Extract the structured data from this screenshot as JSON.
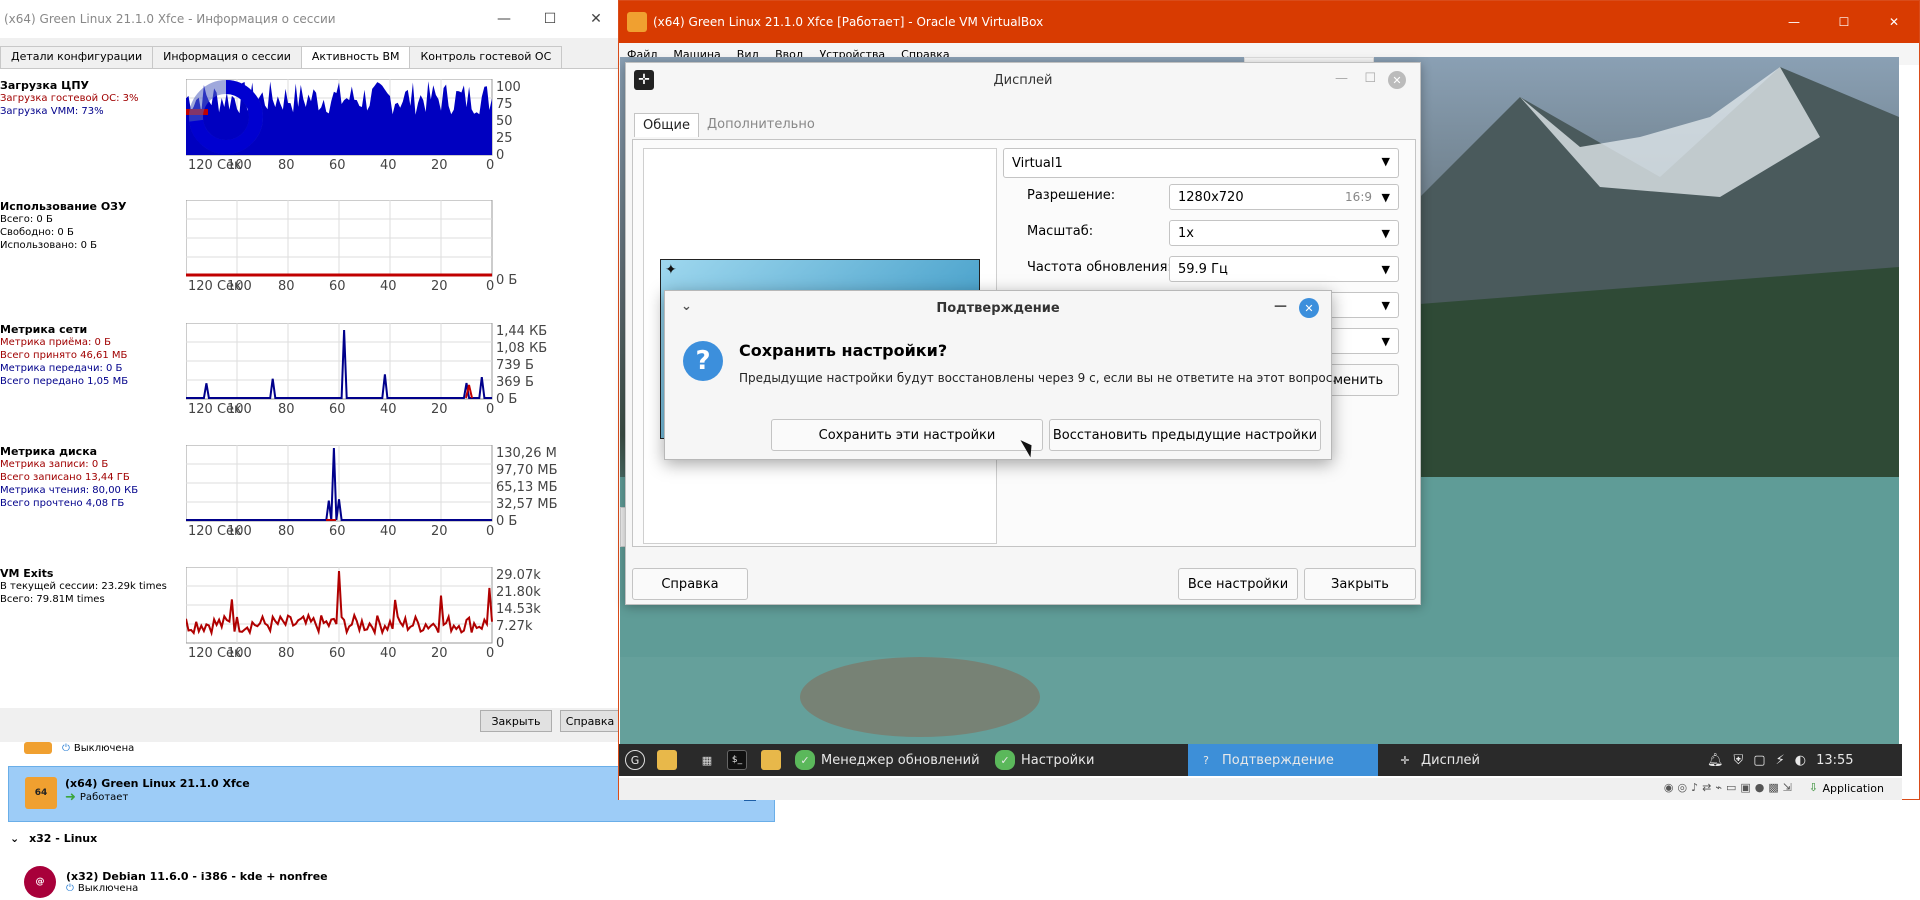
{
  "session_window": {
    "title": "(x64) Green Linux 21.1.0 Xfce - Информация о сессии",
    "tabs": [
      "Детали конфигурации",
      "Информация о сессии",
      "Активность ВМ",
      "Контроль гостевой ОС"
    ],
    "active_tab": 2,
    "x_ticks": [
      "120 Сек",
      "100",
      "80",
      "60",
      "40",
      "20",
      "0"
    ],
    "cpu": {
      "heading": "Загрузка ЦПУ",
      "lines": [
        "Загрузка гостевой ОС: 3%",
        "Загрузка VMM: 73%"
      ],
      "y_ticks": [
        "100",
        "75",
        "50",
        "25",
        "0"
      ],
      "donut_percent": 73
    },
    "ram": {
      "heading": "Использование ОЗУ",
      "lines": [
        "Всего: 0 Б",
        "Свободно: 0 Б",
        "Использовано: 0 Б"
      ],
      "y_ticks": [
        "0 Б"
      ]
    },
    "net": {
      "heading": "Метрика сети",
      "lines": [
        "Метрика приёма: 0 Б",
        "Всего принято 46,61 МБ",
        "Метрика передачи: 0 Б",
        "Всего передано 1,05 МБ"
      ],
      "y_ticks": [
        "1,44 КБ",
        "1,08 КБ",
        "739 Б",
        "369 Б",
        "0 Б"
      ]
    },
    "disk": {
      "heading": "Метрика диска",
      "lines": [
        "Метрика записи: 0 Б",
        "Всего записано 13,44 ГБ",
        "Метрика чтения: 80,00 КБ",
        "Всего прочтено 4,08 ГБ"
      ],
      "y_ticks": [
        "130,26 М",
        "97,70 МБ",
        "65,13 МБ",
        "32,57 МБ",
        "0 Б"
      ]
    },
    "exits": {
      "heading": "VM Exits",
      "lines": [
        "В текущей сессии: 23.29k times",
        "Всего: 79.81M times"
      ],
      "y_ticks": [
        "29.07k",
        "21.80k",
        "14.53k",
        "7.27k",
        "0"
      ]
    },
    "close_label": "Закрыть",
    "help_label": "Справка"
  },
  "vm_list": {
    "items": [
      {
        "name": "",
        "state": "Выключена"
      },
      {
        "name": "(x64) Green Linux 21.1.0 Xfce",
        "state": "Работает",
        "icon_label": "64"
      },
      {
        "name": "(x32) Debian 11.6.0 - i386 - kde + nonfree",
        "state": "Выключена"
      }
    ],
    "group_label": "x32 - Linux"
  },
  "vbox": {
    "title": "(x64) Green Linux 21.1.0 Xfce [Работает] - Oracle VM VirtualBox",
    "menu": [
      "Файл",
      "Машина",
      "Вид",
      "Ввод",
      "Устройства",
      "Справка"
    ],
    "status_app": "Application"
  },
  "display_dialog": {
    "title": "Дисплей",
    "tabs": [
      "Общие",
      "Дополнительно"
    ],
    "monitor": "Virtual1",
    "fields": [
      {
        "label": "Разрешение:",
        "value": "1280x720",
        "extra": "16:9"
      },
      {
        "label": "Масштаб:",
        "value": "1x"
      },
      {
        "label": "Частота обновления:",
        "value": "59.9 Гц"
      }
    ],
    "apply_partial": "именить",
    "help": "Справка",
    "all_settings": "Все настройки",
    "close": "Закрыть"
  },
  "confirm_dialog": {
    "title": "Подтверждение",
    "question": "Сохранить настройки?",
    "message": "Предыдущие настройки будут восстановлены через 9 с, если вы не ответите на этот вопрос.",
    "keep": "Сохранить эти настройки",
    "revert": "Восстановить предыдущие настройки"
  },
  "taskbar": {
    "items": [
      "Менеджер обновлений",
      "Настройки",
      "Подтверждение",
      "Дисплей"
    ],
    "active": 2,
    "clock": "13:55"
  },
  "colors": {
    "vbox_title": "#d83b01",
    "cpu_fill": "#0000c0",
    "guest_red": "#c00000",
    "taskbar": "#2a2a2a",
    "taskbar_active": "#3d8fd8",
    "question_icon": "#3c8fdc"
  }
}
